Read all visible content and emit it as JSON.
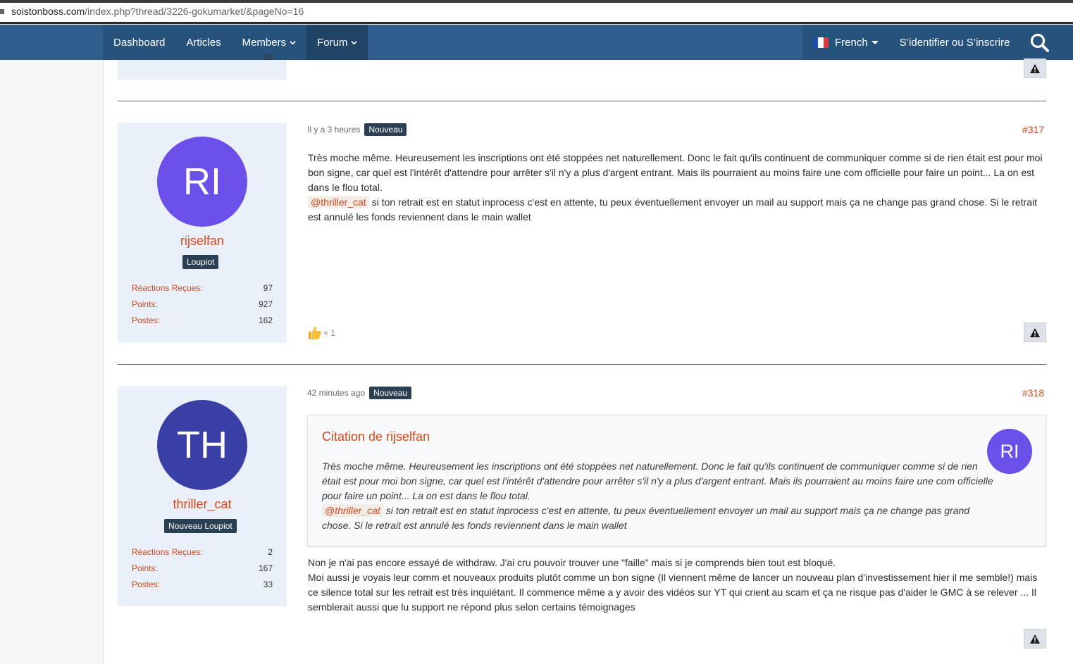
{
  "browser": {
    "url_host": "soistonboss.com",
    "url_path": "/index.php?thread/3226-gokumarket/&pageNo=16"
  },
  "nav": {
    "items": [
      {
        "label": "Dashboard"
      },
      {
        "label": "Articles"
      },
      {
        "label": "Members"
      },
      {
        "label": "Forum"
      }
    ],
    "language": "French",
    "login": "S’identifier ou S’inscrire"
  },
  "top_fragment": {
    "stat_value": "33"
  },
  "posts": [
    {
      "number": "#317",
      "time": "Il y a 3 heures",
      "new_label": "Nouveau",
      "user": {
        "initials": "RI",
        "name": "rijselfan",
        "rank": "Loupiot",
        "avatar_color": "#6c4ee9",
        "stats": [
          {
            "label": "Réactions Reçues:",
            "value": "97"
          },
          {
            "label": "Points:",
            "value": "927"
          },
          {
            "label": "Postes:",
            "value": "162"
          }
        ]
      },
      "body_line1": "Très moche même. Heureusement les inscriptions ont été stoppées net naturellement. Donc le fait qu'ils continuent de communiquer comme si de rien était est pour moi bon signe, car quel est l'intérêt d'attendre pour arrêter s'il n'y a plus d'argent entrant. Mais ils pourraient au moins faire une com officielle pour faire un point... La on est dans le flou total.",
      "mention": "@thriller_cat",
      "body_line2": "si ton retrait est en statut inprocess c'est en attente, tu peux éventuellement envoyer un mail au support mais ça ne change pas grand chose. Si le retrait est annulé les fonds reviennent dans le main wallet",
      "reaction_count": "× 1"
    },
    {
      "number": "#318",
      "time": "42 minutes ago",
      "new_label": "Nouveau",
      "user": {
        "initials": "TH",
        "name": "thriller_cat",
        "rank": "Nouveau Loupiot",
        "avatar_color": "#3a3fa6",
        "stats": [
          {
            "label": "Réactions Reçues:",
            "value": "2"
          },
          {
            "label": "Points:",
            "value": "167"
          },
          {
            "label": "Postes:",
            "value": "33"
          }
        ]
      },
      "quote": {
        "title": "Citation de rijselfan",
        "avatar_initials": "RI",
        "line1": "Très moche même. Heureusement les inscriptions ont été stoppées net naturellement. Donc le fait qu'ils continuent de communiquer comme si de rien était est pour moi bon signe, car quel est l'intérêt d'attendre pour arrêter s'il n'y a plus d'argent entrant. Mais ils pourraient au moins faire une com officielle pour faire un point... La on est dans le flou total.",
        "mention": "@thriller_cat",
        "line2": "si ton retrait est en statut inprocess c'est en attente, tu peux éventuellement envoyer un mail au support mais ça ne change pas grand chose. Si le retrait est annulé les fonds reviennent dans le main wallet"
      },
      "body_line1": "Non je n'ai pas encore essayé de withdraw. J'ai cru pouvoir trouver une \"faille\" mais si je comprends bien tout est bloqué.",
      "body_line2": "Moi aussi je voyais leur comm et nouveaux produits plutôt comme un bon signe (Il viennent même de lancer un nouveau plan d'investissement hier il me semble!) mais ce silence total sur les retrait est très inquiétant. Il commence même a y avoir des vidéos sur YT qui crient au scam et ça ne risque pas d'aider le GMC à se relever ... Il semblerait aussi que lu support ne répond plus selon certains témoignages"
    }
  ],
  "colors": {
    "accent": "#d2481c",
    "nav": "#2f5e8c",
    "badge": "#2b3f52"
  }
}
